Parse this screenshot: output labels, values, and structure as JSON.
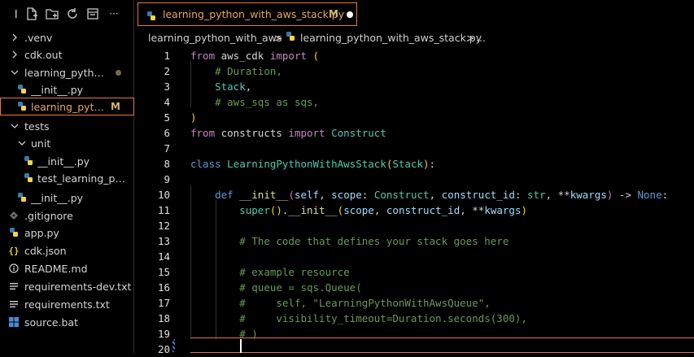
{
  "sidebar": {
    "toolbar": [
      {
        "icon": "more-icon"
      },
      {
        "icon": "new-file-icon"
      },
      {
        "icon": "new-folder-icon"
      },
      {
        "icon": "refresh-icon"
      },
      {
        "icon": "collapse-all-icon"
      },
      {
        "icon": "ellipsis-icon",
        "label": "···"
      }
    ],
    "items": [
      {
        "label": ".venv",
        "type": "folder",
        "state": "collapsed"
      },
      {
        "label": "cdk.out",
        "type": "folder",
        "state": "collapsed"
      },
      {
        "label": "learning_pytho...",
        "type": "folder",
        "state": "expanded",
        "modified_dot": true
      },
      {
        "label": "__init__.py",
        "type": "python"
      },
      {
        "label": "learning_pytho...",
        "type": "python",
        "badge": "M",
        "selected": true
      },
      {
        "label": "tests",
        "type": "folder",
        "state": "expanded"
      },
      {
        "label": "unit",
        "type": "folder",
        "state": "expanded"
      },
      {
        "label": "__init__.py",
        "type": "python"
      },
      {
        "label": "test_learning_pyth...",
        "type": "python"
      },
      {
        "label": "__init__.py",
        "type": "python"
      },
      {
        "label": ".gitignore",
        "type": "git"
      },
      {
        "label": "app.py",
        "type": "python"
      },
      {
        "label": "cdk.json",
        "type": "json",
        "icon_text": "{}"
      },
      {
        "label": "README.md",
        "type": "info"
      },
      {
        "label": "requirements-dev.txt",
        "type": "text"
      },
      {
        "label": "requirements.txt",
        "type": "text"
      },
      {
        "label": "source.bat",
        "type": "windows"
      }
    ]
  },
  "tab": {
    "label": "learning_python_with_aws_stack.py",
    "badge": "M"
  },
  "breadcrumb": {
    "folder": "learning_python_with_aws",
    "sep": ">",
    "file": "learning_python_with_aws_stack.py",
    "tail": "..."
  },
  "editor": {
    "line_numbers": [
      "1",
      "2",
      "3",
      "4",
      "5",
      "6",
      "7",
      "8",
      "9",
      "10",
      "11",
      "12",
      "13",
      "14",
      "15",
      "16",
      "17",
      "18",
      "19",
      "20"
    ]
  },
  "colors": {
    "accent": "#e5793f",
    "modified": "#d6b36e"
  }
}
